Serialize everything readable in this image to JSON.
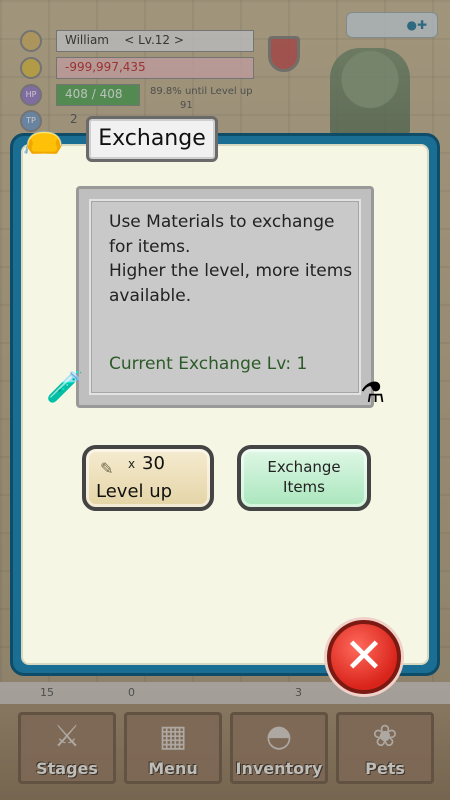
{
  "hud": {
    "player_name": "William",
    "level": "< Lv.12 >",
    "gold": "-999,997,435",
    "hp_label": "HP",
    "hp": "408 / 408",
    "tp_label": "TP",
    "tp_value": "2",
    "level_up_info": "89.8% until Level up",
    "sub_value": "91"
  },
  "dialog": {
    "title": "Exchange",
    "description": "Use Materials to exchange for items.\nHigher the level, more items available.",
    "current_level": "Current Exchange Lv: 1",
    "level_up_button": {
      "multiplier": "x",
      "cost": "30",
      "label": "Level up"
    },
    "exchange_button_label": "Exchange Items"
  },
  "bottom_counters": [
    "15",
    "0",
    "3"
  ],
  "nav": {
    "stages": "Stages",
    "menu": "Menu",
    "inventory": "Inventory",
    "pets": "Pets"
  },
  "colors": {
    "dialog_border": "#1a6e93",
    "level_up_bg": "#f0e4c2",
    "exchange_bg": "#c2eed0",
    "close_red": "#d9241b",
    "level_text": "#2d5a28"
  },
  "icons": [
    "bag-icon",
    "scroll-icon",
    "close-icon",
    "sword-icon",
    "book-icon",
    "backpack-icon",
    "pet-icon"
  ]
}
